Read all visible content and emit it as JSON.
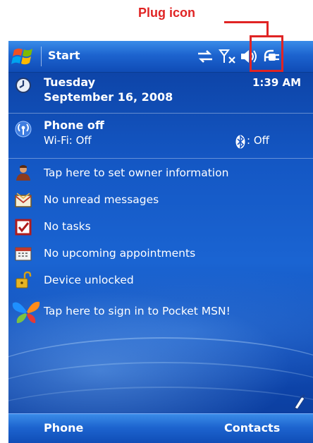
{
  "annotation": {
    "label": "Plug icon",
    "color": "#e02424"
  },
  "titlebar": {
    "start_label": "Start"
  },
  "status_icons": [
    "sync-arrows-icon",
    "signal-off-icon",
    "speaker-icon",
    "plug-icon"
  ],
  "today": {
    "day": "Tuesday",
    "date": "September 16, 2008",
    "time": "1:39 AM",
    "phone_status": "Phone off",
    "wifi": "Wi-Fi: Off",
    "bluetooth": ": Off",
    "owner_info": "Tap here to set owner information",
    "messages": "No unread messages",
    "tasks": "No tasks",
    "appointments": "No upcoming appointments",
    "lock_status": "Device unlocked",
    "msn": "Tap here to sign in to Pocket MSN!"
  },
  "softkeys": {
    "left": "Phone",
    "right": "Contacts"
  }
}
